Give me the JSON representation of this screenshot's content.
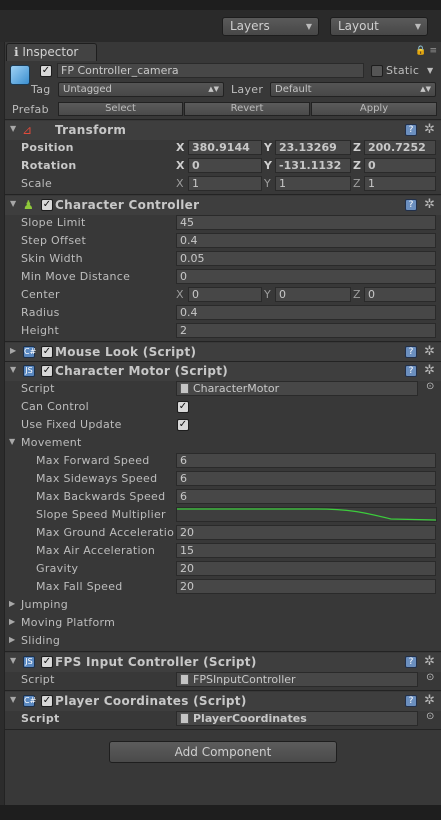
{
  "toolbar": {
    "layers": "Layers",
    "layout": "Layout"
  },
  "inspector": {
    "tab": "Inspector"
  },
  "gameobject": {
    "name": "FP Controller_camera",
    "static_label": "Static",
    "tag_label": "Tag",
    "tag_value": "Untagged",
    "layer_label": "Layer",
    "layer_value": "Default",
    "prefab_label": "Prefab",
    "select": "Select",
    "revert": "Revert",
    "apply": "Apply"
  },
  "transform": {
    "title": "Transform",
    "position": {
      "label": "Position",
      "x": "380.9144",
      "y": "23.13269",
      "z": "200.7252"
    },
    "rotation": {
      "label": "Rotation",
      "x": "0",
      "y": "-131.1132",
      "z": "0"
    },
    "scale": {
      "label": "Scale",
      "x": "1",
      "y": "1",
      "z": "1"
    }
  },
  "character_controller": {
    "title": "Character Controller",
    "slope_limit": {
      "label": "Slope Limit",
      "value": "45"
    },
    "step_offset": {
      "label": "Step Offset",
      "value": "0.4"
    },
    "skin_width": {
      "label": "Skin Width",
      "value": "0.05"
    },
    "min_move": {
      "label": "Min Move Distance",
      "value": "0"
    },
    "center": {
      "label": "Center",
      "x": "0",
      "y": "0",
      "z": "0"
    },
    "radius": {
      "label": "Radius",
      "value": "0.4"
    },
    "height": {
      "label": "Height",
      "value": "2"
    }
  },
  "mouse_look": {
    "title": "Mouse Look (Script)"
  },
  "character_motor": {
    "title": "Character Motor (Script)",
    "script": {
      "label": "Script",
      "value": "CharacterMotor"
    },
    "can_control": "Can Control",
    "use_fixed_update": "Use Fixed Update",
    "movement": "Movement",
    "max_forward": {
      "label": "Max Forward Speed",
      "value": "6"
    },
    "max_sideways": {
      "label": "Max Sideways Speed",
      "value": "6"
    },
    "max_backwards": {
      "label": "Max Backwards Speed",
      "value": "6"
    },
    "slope_multiplier": "Slope Speed Multiplier",
    "max_ground_accel": {
      "label": "Max Ground Acceleratio",
      "value": "20"
    },
    "max_air_accel": {
      "label": "Max Air Acceleration",
      "value": "15"
    },
    "gravity": {
      "label": "Gravity",
      "value": "20"
    },
    "max_fall": {
      "label": "Max Fall Speed",
      "value": "20"
    },
    "jumping": "Jumping",
    "moving_platform": "Moving Platform",
    "sliding": "Sliding"
  },
  "fps_input": {
    "title": "FPS Input Controller (Script)",
    "script_label": "Script",
    "script_value": "FPSInputController"
  },
  "player_coords": {
    "title": "Player Coordinates (Script)",
    "script_label": "Script",
    "script_value": "PlayerCoordinates"
  },
  "add_component": "Add Component",
  "axes": {
    "x": "X",
    "y": "Y",
    "z": "Z"
  },
  "colors": {
    "curve": "#3ccc3c",
    "help": "#6b8fbf"
  }
}
